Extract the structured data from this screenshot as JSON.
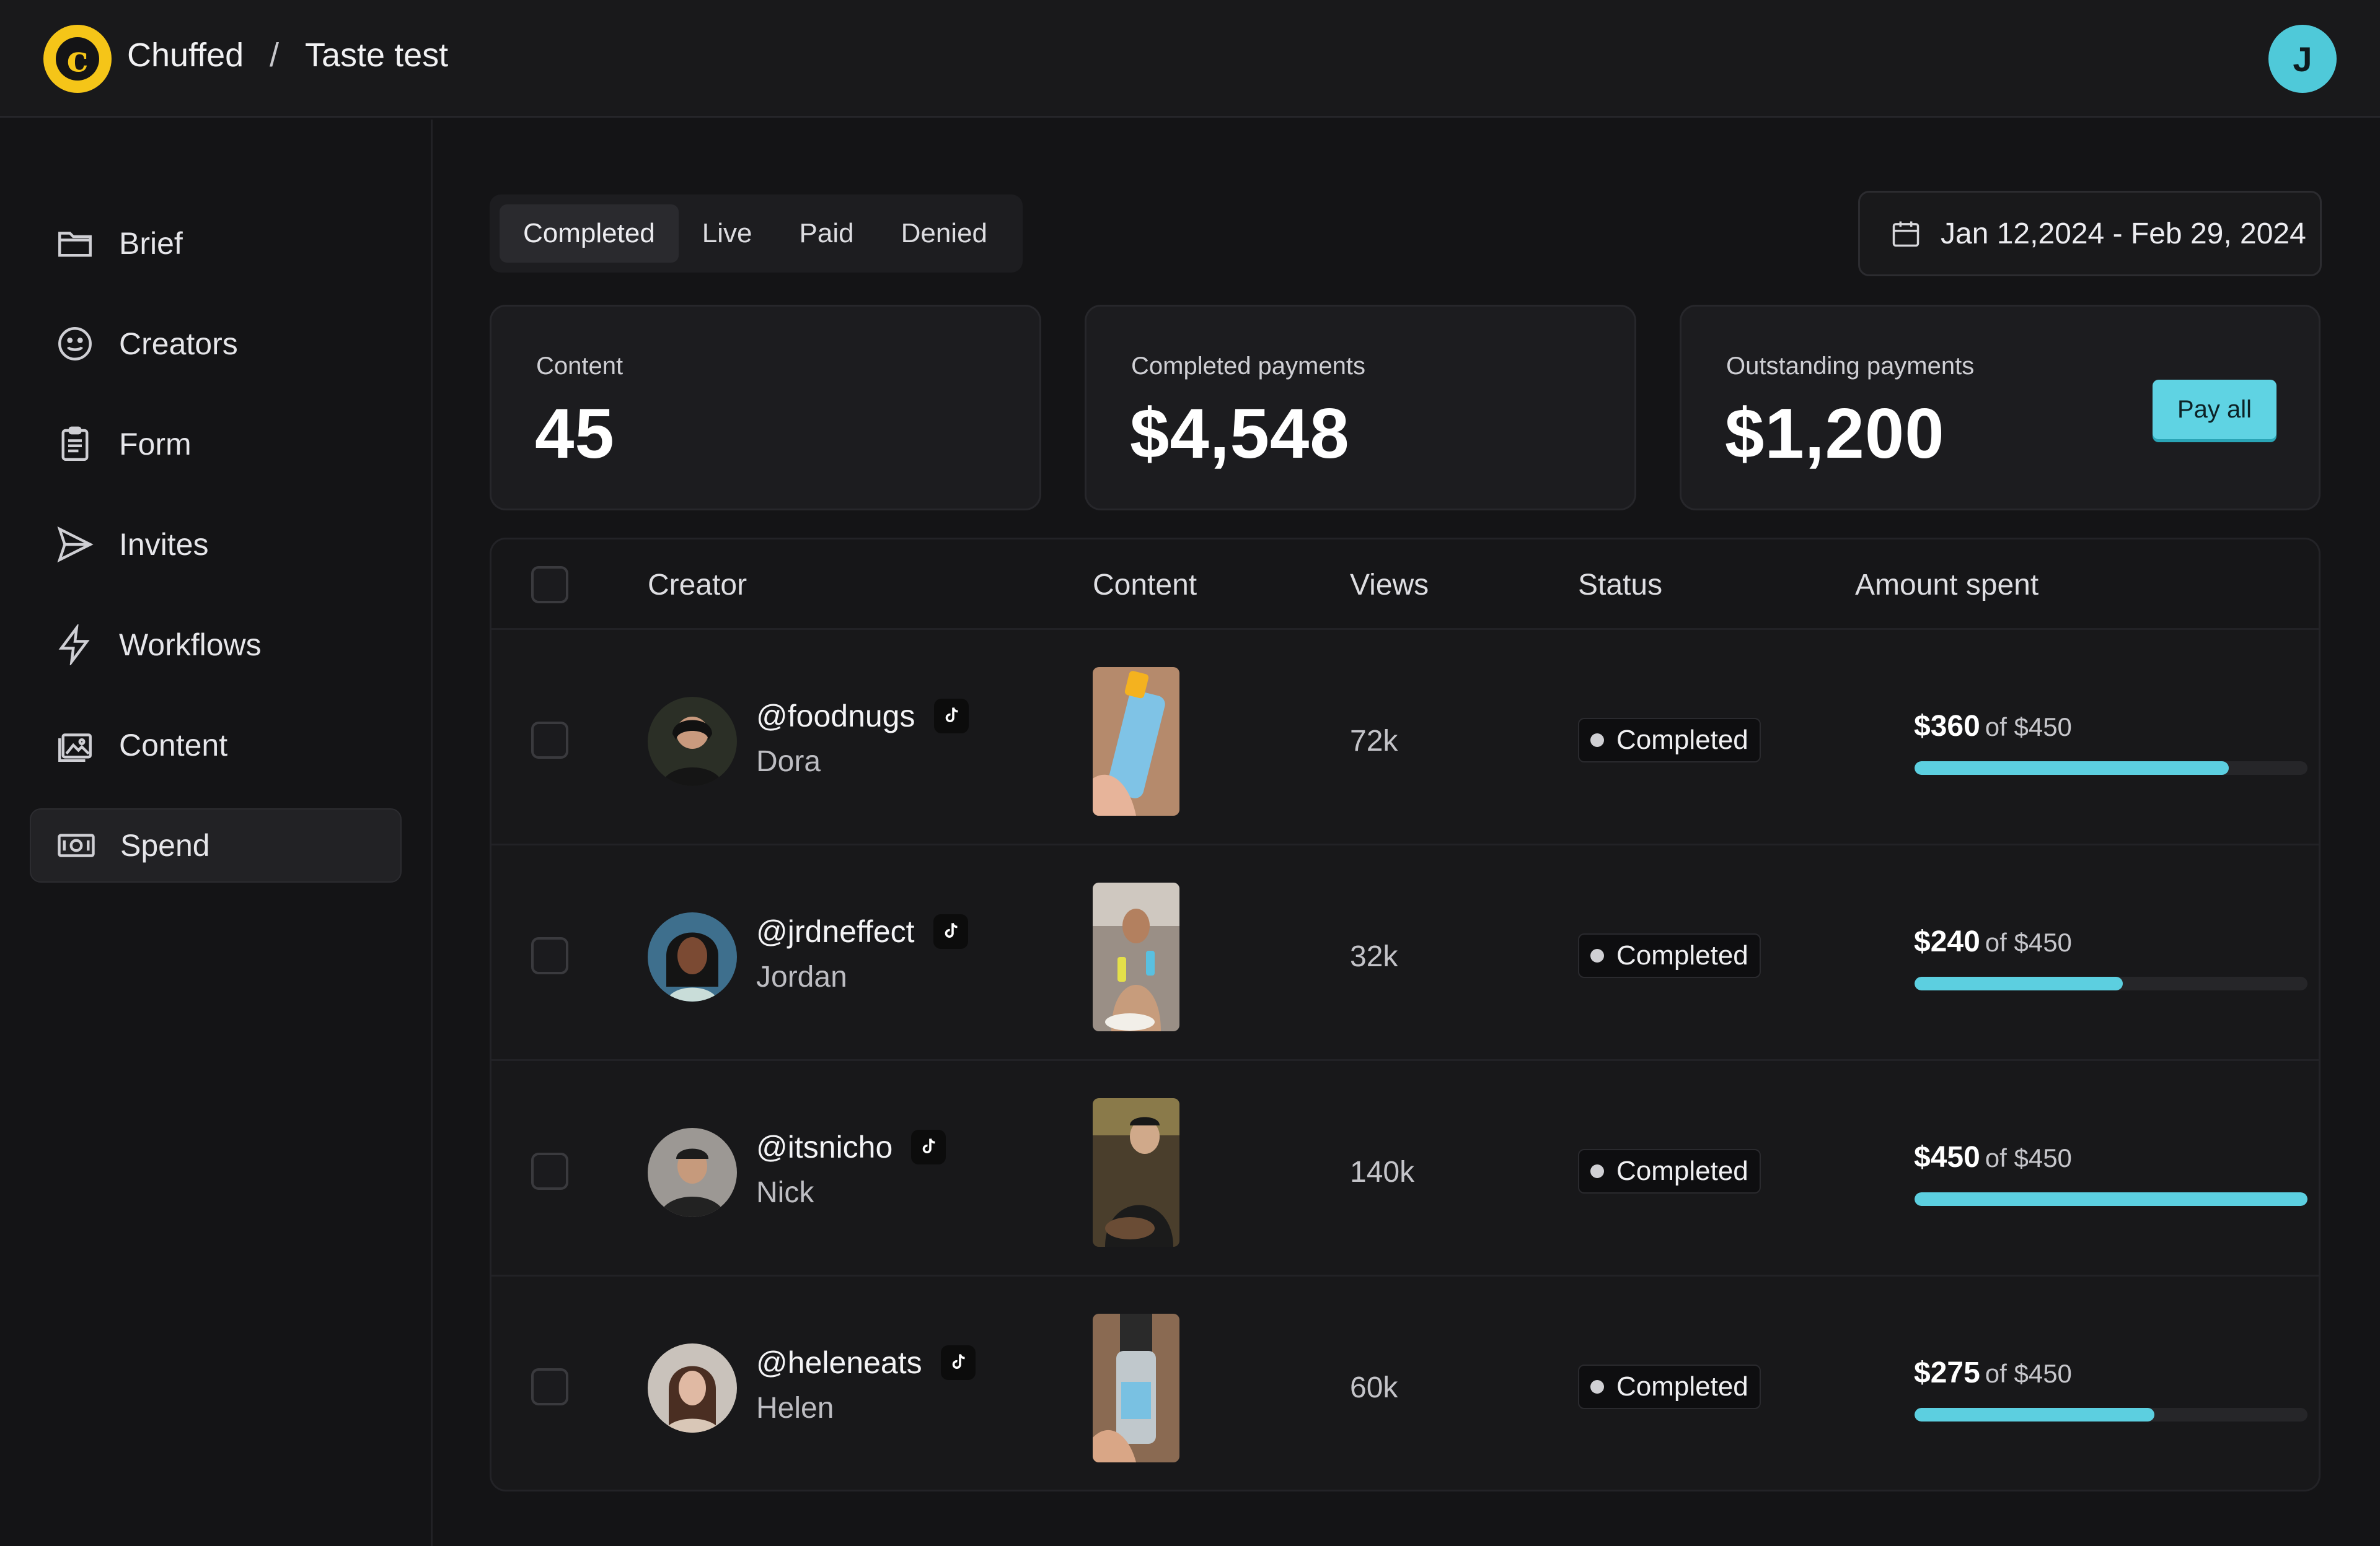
{
  "header": {
    "brand": "Chuffed",
    "separator": "/",
    "page": "Taste test",
    "user_initial": "J"
  },
  "sidebar": {
    "items": [
      {
        "label": "Brief",
        "icon": "folder-icon"
      },
      {
        "label": "Creators",
        "icon": "smiley-icon"
      },
      {
        "label": "Form",
        "icon": "clipboard-icon"
      },
      {
        "label": "Invites",
        "icon": "send-icon"
      },
      {
        "label": "Workflows",
        "icon": "lightning-icon"
      },
      {
        "label": "Content",
        "icon": "image-gallery-icon"
      },
      {
        "label": "Spend",
        "icon": "cash-icon",
        "active": true
      }
    ]
  },
  "tabs": {
    "items": [
      "Completed",
      "Live",
      "Paid",
      "Denied"
    ],
    "selected": "Completed"
  },
  "date_range": "Jan 12,2024 - Feb 29, 2024",
  "stats": {
    "content": {
      "label": "Content",
      "value": "45"
    },
    "completed": {
      "label": "Completed payments",
      "value": "$4,548"
    },
    "outstanding": {
      "label": "Outstanding payments",
      "value": "$1,200",
      "action": "Pay all"
    }
  },
  "table": {
    "headers": {
      "creator": "Creator",
      "content": "Content",
      "views": "Views",
      "status": "Status",
      "amount": "Amount spent"
    },
    "rows": [
      {
        "handle": "@foodnugs",
        "name": "Dora",
        "views": "72k",
        "status": "Completed",
        "amount": "$360",
        "of": "of $450",
        "progress": 0.8
      },
      {
        "handle": "@jrdneffect",
        "name": "Jordan",
        "views": "32k",
        "status": "Completed",
        "amount": "$240",
        "of": "of $450",
        "progress": 0.53
      },
      {
        "handle": "@itsnicho",
        "name": "Nick",
        "views": "140k",
        "status": "Completed",
        "amount": "$450",
        "of": "of $450",
        "progress": 1.0
      },
      {
        "handle": "@heleneats",
        "name": "Helen",
        "views": "60k",
        "status": "Completed",
        "amount": "$275",
        "of": "of $450",
        "progress": 0.61
      }
    ]
  },
  "colors": {
    "accent": "#5ccfe0",
    "brand_yellow": "#f5c518",
    "background": "#141416"
  }
}
